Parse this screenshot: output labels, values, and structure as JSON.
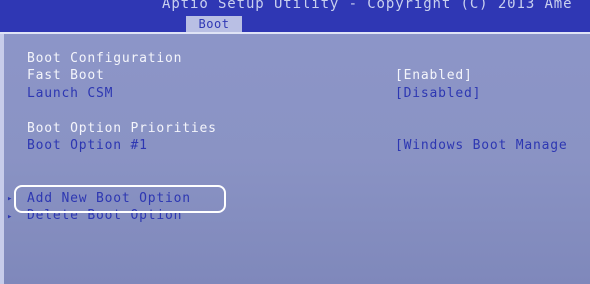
{
  "header": {
    "title": "Aptio Setup Utility - Copyright (C) 2013 Ame",
    "active_tab": "Boot"
  },
  "sections": {
    "boot_configuration": {
      "heading": "Boot Configuration",
      "items": [
        {
          "label": "Fast Boot",
          "value": "[Enabled]"
        },
        {
          "label": "Launch CSM",
          "value": "[Disabled]"
        }
      ]
    },
    "boot_option_priorities": {
      "heading": "Boot Option Priorities",
      "items": [
        {
          "label": "Boot Option #1",
          "value": "[Windows Boot Manage"
        }
      ]
    }
  },
  "submenus": [
    {
      "label": "Add New Boot Option",
      "marker": "▸"
    },
    {
      "label": "Delete Boot Option",
      "marker": "▸"
    }
  ],
  "colors": {
    "header_bg": "#2f37b4",
    "body_bg": "#8a93c6",
    "selectable_text": "#2d37b2",
    "static_text": "#f4f5fb",
    "highlight_outline": "#ffffff"
  }
}
